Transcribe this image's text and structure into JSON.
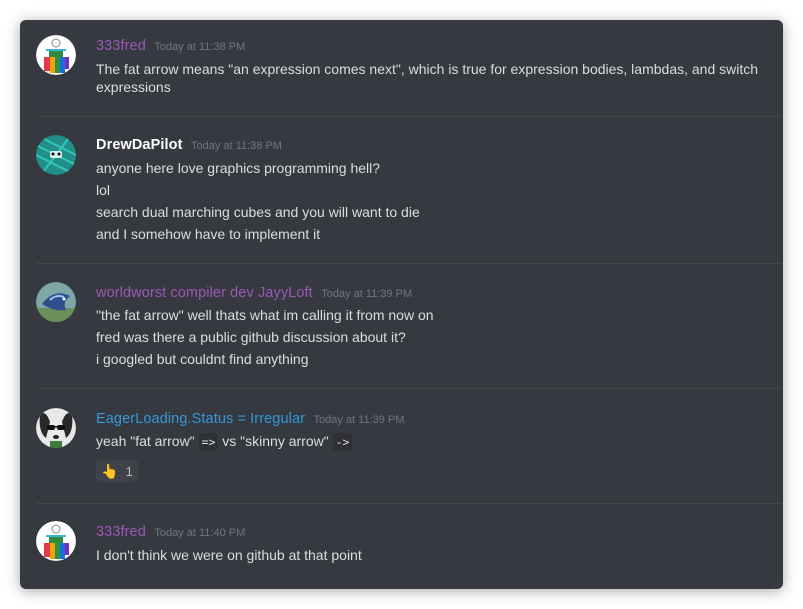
{
  "colors": {
    "background": "#36393f",
    "text": "#dcddde",
    "timestamp": "#72767d",
    "purple_name": "#9b59b6",
    "white_name": "#ffffff",
    "blue_name": "#3498db"
  },
  "messages": [
    {
      "username": "333fred",
      "name_color": "#9b59b6",
      "timestamp": "Today at 11:38 PM",
      "lines": [
        "The fat arrow means \"an expression comes next\", which is true for expression bodies, lambdas, and switch",
        "expressions"
      ]
    },
    {
      "username": "DrewDaPilot",
      "name_color": "#ffffff",
      "timestamp": "Today at 11:38 PM",
      "lines": [
        "anyone here love graphics programming hell?",
        "lol",
        "search dual marching cubes and you will want to die",
        "and I somehow have to implement it"
      ]
    },
    {
      "username": "worldworst compiler dev JayyLoft",
      "name_color": "#9b59b6",
      "timestamp": "Today at 11:39 PM",
      "lines": [
        "\"the fat arrow\" well thats what im calling it from now on",
        "fred was there a public github discussion about it?",
        "i googled but couldnt find anything"
      ]
    },
    {
      "username": "EagerLoading.Status = Irregular",
      "name_color": "#3498db",
      "timestamp": "Today at 11:39 PM",
      "text_parts": {
        "a": "yeah \"fat arrow\" ",
        "code1": "=>",
        "b": " vs \"skinny  arrow\" ",
        "code2": "->"
      },
      "reaction": {
        "emoji_icon": "pointing-hand-icon",
        "emoji": "👆",
        "count": "1"
      }
    },
    {
      "username": "333fred",
      "name_color": "#9b59b6",
      "timestamp": "Today at 11:40 PM",
      "lines": [
        "I don't think we were on github at that point"
      ]
    }
  ]
}
